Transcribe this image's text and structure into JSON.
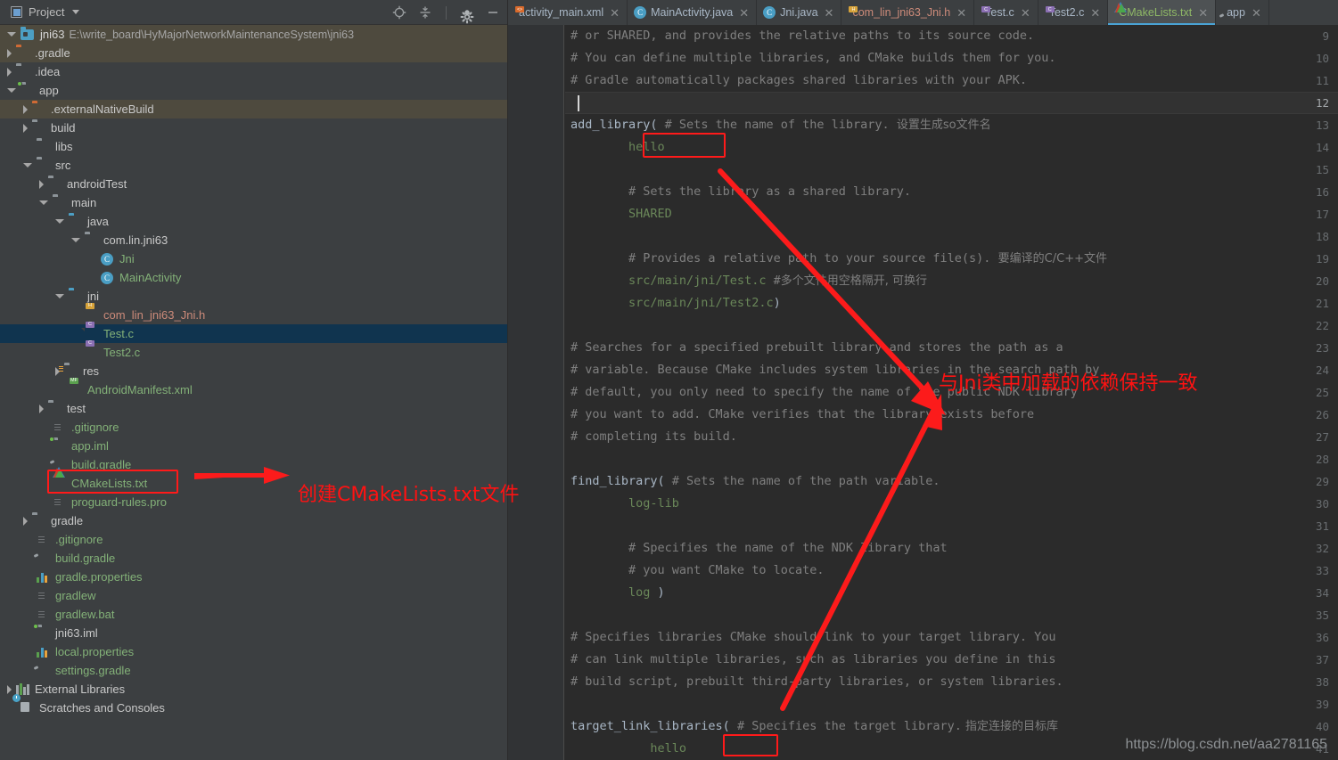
{
  "window": {
    "panel_title": "Project",
    "toolbar_icons": [
      "locate-icon",
      "collapse-all-icon",
      "settings-gear-icon",
      "minimize-icon"
    ]
  },
  "project": {
    "root_name": "jni63",
    "root_path": "E:\\write_board\\HyMajorNetworkMaintenanceSystem\\jni63",
    "tree": [
      {
        "label": ".gradle",
        "indent": 1,
        "icon": "folder-orange",
        "arrow": "right",
        "color": "plain",
        "rowstyle": "olive"
      },
      {
        "label": ".idea",
        "indent": 1,
        "icon": "folder-grey",
        "arrow": "right",
        "color": "plain",
        "rowstyle": "none"
      },
      {
        "label": "app",
        "indent": 1,
        "icon": "folder-module",
        "arrow": "down",
        "color": "plain",
        "rowstyle": "none"
      },
      {
        "label": ".externalNativeBuild",
        "indent": 2,
        "icon": "folder-orange",
        "arrow": "right",
        "color": "plain",
        "rowstyle": "olive"
      },
      {
        "label": "build",
        "indent": 2,
        "icon": "folder-grey",
        "arrow": "right",
        "color": "plain",
        "rowstyle": "none"
      },
      {
        "label": "libs",
        "indent": 2,
        "icon": "folder-grey",
        "arrow": "none",
        "color": "plain",
        "rowstyle": "none"
      },
      {
        "label": "src",
        "indent": 2,
        "icon": "folder-grey",
        "arrow": "down",
        "color": "plain",
        "rowstyle": "none"
      },
      {
        "label": "androidTest",
        "indent": 3,
        "icon": "folder-grey",
        "arrow": "right",
        "color": "plain",
        "rowstyle": "none"
      },
      {
        "label": "main",
        "indent": 3,
        "icon": "folder-grey",
        "arrow": "down",
        "color": "plain",
        "rowstyle": "none"
      },
      {
        "label": "java",
        "indent": 4,
        "icon": "folder-blue",
        "arrow": "down",
        "color": "plain",
        "rowstyle": "none"
      },
      {
        "label": "com.lin.jni63",
        "indent": 5,
        "icon": "folder-package",
        "arrow": "down",
        "color": "plain",
        "rowstyle": "none"
      },
      {
        "label": "Jni",
        "indent": 6,
        "icon": "class-icon",
        "arrow": "none",
        "color": "green",
        "rowstyle": "none"
      },
      {
        "label": "MainActivity",
        "indent": 6,
        "icon": "class-icon",
        "arrow": "none",
        "color": "green",
        "rowstyle": "none"
      },
      {
        "label": "jni",
        "indent": 4,
        "icon": "folder-blue",
        "arrow": "down",
        "color": "plain",
        "rowstyle": "none"
      },
      {
        "label": "com_lin_jni63_Jni.h",
        "indent": 5,
        "icon": "file-h",
        "arrow": "none",
        "color": "salmon",
        "rowstyle": "none"
      },
      {
        "label": "Test.c",
        "indent": 5,
        "icon": "file-c",
        "arrow": "none",
        "color": "green",
        "rowstyle": "selected"
      },
      {
        "label": "Test2.c",
        "indent": 5,
        "icon": "file-c",
        "arrow": "none",
        "color": "green",
        "rowstyle": "none"
      },
      {
        "label": "res",
        "indent": 4,
        "icon": "folder-res",
        "arrow": "right",
        "color": "plain",
        "rowstyle": "none"
      },
      {
        "label": "AndroidManifest.xml",
        "indent": 4,
        "icon": "file-mf",
        "arrow": "none",
        "color": "green",
        "rowstyle": "none"
      },
      {
        "label": "test",
        "indent": 3,
        "icon": "folder-grey",
        "arrow": "right",
        "color": "plain",
        "rowstyle": "none"
      },
      {
        "label": ".gitignore",
        "indent": 3,
        "icon": "doc-icon",
        "arrow": "none",
        "color": "green",
        "rowstyle": "none"
      },
      {
        "label": "app.iml",
        "indent": 3,
        "icon": "folder-module",
        "arrow": "none",
        "color": "green",
        "rowstyle": "none"
      },
      {
        "label": "build.gradle",
        "indent": 3,
        "icon": "gradle-icon",
        "arrow": "none",
        "color": "green",
        "rowstyle": "none"
      },
      {
        "label": "CMakeLists.txt",
        "indent": 3,
        "icon": "cmake-icon",
        "arrow": "none",
        "color": "green",
        "rowstyle": "none"
      },
      {
        "label": "proguard-rules.pro",
        "indent": 3,
        "icon": "doc-icon",
        "arrow": "none",
        "color": "green",
        "rowstyle": "none"
      },
      {
        "label": "gradle",
        "indent": 2,
        "icon": "folder-grey",
        "arrow": "right",
        "color": "plain",
        "rowstyle": "none"
      },
      {
        "label": ".gitignore",
        "indent": 2,
        "icon": "doc-icon",
        "arrow": "none",
        "color": "green",
        "rowstyle": "none"
      },
      {
        "label": "build.gradle",
        "indent": 2,
        "icon": "gradle-icon",
        "arrow": "none",
        "color": "green",
        "rowstyle": "none"
      },
      {
        "label": "gradle.properties",
        "indent": 2,
        "icon": "props-icon",
        "arrow": "none",
        "color": "green",
        "rowstyle": "none"
      },
      {
        "label": "gradlew",
        "indent": 2,
        "icon": "doc-icon",
        "arrow": "none",
        "color": "green",
        "rowstyle": "none"
      },
      {
        "label": "gradlew.bat",
        "indent": 2,
        "icon": "doc-icon",
        "arrow": "none",
        "color": "green",
        "rowstyle": "none"
      },
      {
        "label": "jni63.iml",
        "indent": 2,
        "icon": "folder-module",
        "arrow": "none",
        "color": "plain",
        "rowstyle": "none"
      },
      {
        "label": "local.properties",
        "indent": 2,
        "icon": "props-icon",
        "arrow": "none",
        "color": "green",
        "rowstyle": "none"
      },
      {
        "label": "settings.gradle",
        "indent": 2,
        "icon": "gradle-icon",
        "arrow": "none",
        "color": "green",
        "rowstyle": "none"
      },
      {
        "label": "External Libraries",
        "indent": 1,
        "icon": "extlib-icon",
        "arrow": "right",
        "color": "plain",
        "rowstyle": "none"
      },
      {
        "label": "Scratches and Consoles",
        "indent": 1,
        "icon": "scratch-icon",
        "arrow": "none",
        "color": "plain",
        "rowstyle": "none"
      }
    ]
  },
  "editor": {
    "tabs": [
      {
        "label": "activity_main.xml",
        "icon": "xml-file-icon",
        "color": "#a9b7c6",
        "active": false
      },
      {
        "label": "MainActivity.java",
        "icon": "class-icon",
        "color": "#a9b7c6",
        "active": false
      },
      {
        "label": "Jni.java",
        "icon": "class-icon",
        "color": "#a9b7c6",
        "active": false
      },
      {
        "label": "com_lin_jni63_Jni.h",
        "icon": "header-file-icon",
        "color": "#cd8b7a",
        "active": false
      },
      {
        "label": "Test.c",
        "icon": "c-file-icon",
        "color": "#a9b7c6",
        "active": false
      },
      {
        "label": "Test2.c",
        "icon": "c-file-icon",
        "color": "#a9b7c6",
        "active": false
      },
      {
        "label": "CMakeLists.txt",
        "icon": "cmake-icon",
        "color": "#8fb866",
        "active": true
      },
      {
        "label": "app",
        "icon": "gradle-icon",
        "color": "#a9b7c6",
        "active": false
      }
    ],
    "first_line_number": 9,
    "current_line": 12,
    "lines": [
      {
        "n": 9,
        "segs": [
          {
            "t": "# or SHARED, and provides the relative paths to its source code.",
            "c": "cmt"
          }
        ]
      },
      {
        "n": 10,
        "segs": [
          {
            "t": "# You can define multiple libraries, and CMake builds them for you.",
            "c": "cmt"
          }
        ]
      },
      {
        "n": 11,
        "segs": [
          {
            "t": "# Gradle automatically packages shared libraries with your APK.",
            "c": "cmt"
          }
        ]
      },
      {
        "n": 12,
        "segs": []
      },
      {
        "n": 13,
        "segs": [
          {
            "t": "add_library(",
            "c": "kw"
          },
          {
            "t": " # Sets the name of the library.",
            "c": "cmt"
          },
          {
            "t": "  设置生成so文件名",
            "c": "cn"
          }
        ]
      },
      {
        "n": 14,
        "segs": [
          {
            "t": "        hello",
            "c": "str"
          }
        ]
      },
      {
        "n": 15,
        "segs": []
      },
      {
        "n": 16,
        "segs": [
          {
            "t": "        # Sets the library as a shared library.",
            "c": "cmt"
          }
        ]
      },
      {
        "n": 17,
        "segs": [
          {
            "t": "        SHARED",
            "c": "str"
          }
        ]
      },
      {
        "n": 18,
        "segs": []
      },
      {
        "n": 19,
        "segs": [
          {
            "t": "        # Provides a relative path to your source file(s).",
            "c": "cmt"
          },
          {
            "t": "  要编译的C/C++文件",
            "c": "cn"
          }
        ]
      },
      {
        "n": 20,
        "segs": [
          {
            "t": "        src/main/jni/Test.c",
            "c": "str"
          },
          {
            "t": " #",
            "c": "cmt"
          },
          {
            "t": "多个文件用空格隔开, 可换行",
            "c": "cn"
          }
        ]
      },
      {
        "n": 21,
        "segs": [
          {
            "t": "        src/main/jni/Test2.c",
            "c": "str"
          },
          {
            "t": ")",
            "c": "paren"
          }
        ]
      },
      {
        "n": 22,
        "segs": []
      },
      {
        "n": 23,
        "segs": [
          {
            "t": "# Searches for a specified prebuilt library and stores the path as a",
            "c": "cmt"
          }
        ]
      },
      {
        "n": 24,
        "segs": [
          {
            "t": "# variable. Because CMake includes system libraries in the search path by",
            "c": "cmt"
          }
        ]
      },
      {
        "n": 25,
        "segs": [
          {
            "t": "# default, you only need to specify the name of the public NDK library",
            "c": "cmt"
          }
        ]
      },
      {
        "n": 26,
        "segs": [
          {
            "t": "# you want to add. CMake verifies that the library exists before",
            "c": "cmt"
          }
        ]
      },
      {
        "n": 27,
        "segs": [
          {
            "t": "# completing its build.",
            "c": "cmt"
          }
        ]
      },
      {
        "n": 28,
        "segs": []
      },
      {
        "n": 29,
        "segs": [
          {
            "t": "find_library(",
            "c": "kw"
          },
          {
            "t": " # Sets the name of the path variable.",
            "c": "cmt"
          }
        ]
      },
      {
        "n": 30,
        "segs": [
          {
            "t": "        log-lib",
            "c": "str"
          }
        ]
      },
      {
        "n": 31,
        "segs": []
      },
      {
        "n": 32,
        "segs": [
          {
            "t": "        # Specifies the name of the NDK library that",
            "c": "cmt"
          }
        ]
      },
      {
        "n": 33,
        "segs": [
          {
            "t": "        # you want CMake to locate.",
            "c": "cmt"
          }
        ]
      },
      {
        "n": 34,
        "segs": [
          {
            "t": "        log",
            "c": "str"
          },
          {
            "t": " )",
            "c": "paren"
          }
        ]
      },
      {
        "n": 35,
        "segs": []
      },
      {
        "n": 36,
        "segs": [
          {
            "t": "# Specifies libraries CMake should link to your target library. You",
            "c": "cmt"
          }
        ]
      },
      {
        "n": 37,
        "segs": [
          {
            "t": "# can link multiple libraries, such as libraries you define in this",
            "c": "cmt"
          }
        ]
      },
      {
        "n": 38,
        "segs": [
          {
            "t": "# build script, prebuilt third-party libraries, or system libraries.",
            "c": "cmt"
          }
        ]
      },
      {
        "n": 39,
        "segs": []
      },
      {
        "n": 40,
        "segs": [
          {
            "t": "target_link_libraries(",
            "c": "kw"
          },
          {
            "t": " # Specifies the target library.",
            "c": "cmt"
          },
          {
            "t": " 指定连接的目标库",
            "c": "cn"
          }
        ]
      },
      {
        "n": 41,
        "segs": [
          {
            "t": "           hello",
            "c": "str"
          }
        ]
      }
    ]
  },
  "annotations": {
    "accent_color": "#ff1212",
    "note_create_cmakelists": "创建CMakeLists.txt文件",
    "note_jni_dependency": "与Jni类中加载的依赖保持一致",
    "highlight_boxes": [
      "cmakelists-tree-item",
      "add-library-hello",
      "target-link-hello"
    ]
  },
  "watermark": "https://blog.csdn.net/aa2781165"
}
